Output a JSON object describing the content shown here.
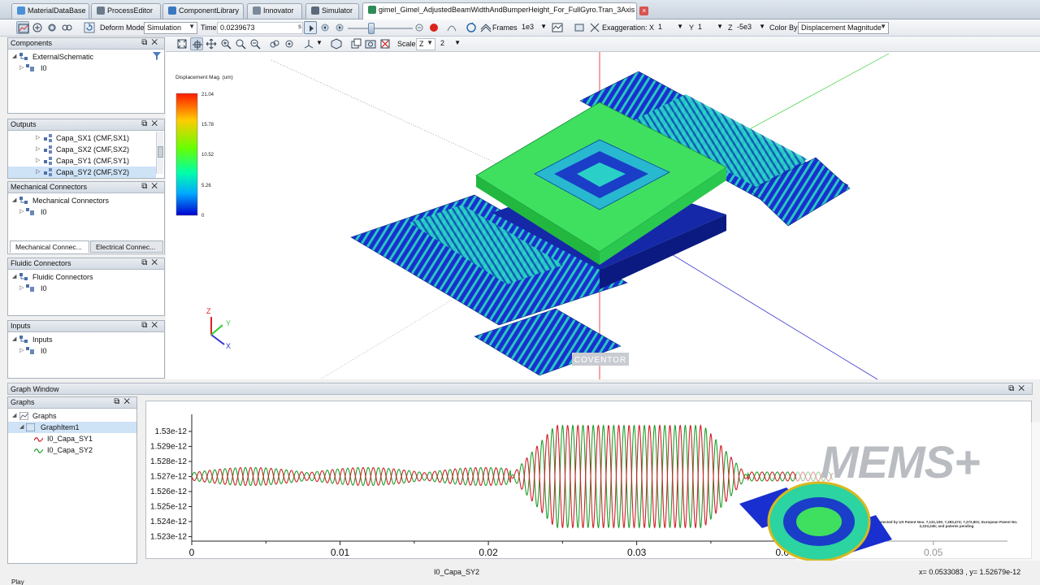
{
  "tabs": [
    {
      "label": "MaterialDataBase",
      "color": "#4a90d9"
    },
    {
      "label": "ProcessEditor",
      "color": "#6b7b8c"
    },
    {
      "label": "ComponentLibrary",
      "color": "#3b78c2"
    },
    {
      "label": "Innovator",
      "color": "#7a8a9a"
    },
    {
      "label": "Simulator",
      "color": "#5a6a7a"
    },
    {
      "label": "gimel_Gimel_AdjustedBeamWidthAndBumperHeight_For_FullGyro.Tran_3Axis",
      "color": "#2e8b57"
    }
  ],
  "toolbar1": {
    "deform_mode_label": "Deform Mode",
    "deform_mode_value": "Simulation",
    "time_label": "Time",
    "time_value": "0.0239673",
    "time_unit": "s",
    "frames_label": "Frames",
    "frames_value": "1e3",
    "exaggeration_label": "Exaggeration: X",
    "exag_x": "1",
    "y_label": "Y",
    "exag_y": "1",
    "z_label": "Z",
    "exag_z": "-5e3",
    "color_by_label": "Color By",
    "color_by_value": "Displacement Magnitude",
    "time_slider_fraction": 0.36
  },
  "toolbar2": {
    "scale_label": "Scale",
    "scale_axis": "Z",
    "scale_value": "2"
  },
  "panels": {
    "components": {
      "title": "Components",
      "items": [
        "ExternalSchematic",
        "I0"
      ]
    },
    "outputs": {
      "title": "Outputs",
      "items": [
        "Capa_SX1 (CMF,SX1)",
        "Capa_SX2 (CMF,SX2)",
        "Capa_SY1 (CMF,SY1)",
        "Capa_SY2 (CMF,SY2)"
      ]
    },
    "mechanical": {
      "title": "Mechanical Connectors",
      "items": [
        "Mechanical Connectors",
        "I0"
      ],
      "tabs": [
        "Mechanical Connec...",
        "Electrical Connec..."
      ]
    },
    "fluidic": {
      "title": "Fluidic Connectors",
      "items": [
        "Fluidic Connectors",
        "I0"
      ]
    },
    "inputs": {
      "title": "Inputs",
      "items": [
        "Inputs",
        "I0"
      ]
    }
  },
  "viewport": {
    "legend_title": "Displacement Mag. (um)",
    "legend_ticks": [
      "21.04",
      "15.78",
      "10.52",
      "5.26",
      "0"
    ],
    "axis_z": "Z",
    "axis_y": "Y",
    "axis_x": "X",
    "watermark": "COVENTOR"
  },
  "graph": {
    "window_title": "Graph Window",
    "panel_title": "Graphs",
    "tree": [
      "Graphs",
      "GraphItem1",
      "I0_Capa_SY1",
      "I0_Capa_SY2"
    ],
    "series_colors": {
      "sy1": "#d0202a",
      "sy2": "#1fa02a"
    },
    "x_axis_label": "I0_Capa_SY2",
    "status": "x= 0.0533083 , y= 1.52679e-12"
  },
  "chart_data": {
    "type": "line",
    "x_ticks": [
      "0",
      "0.01",
      "0.02",
      "0.03",
      "0.04",
      "0.05"
    ],
    "y_ticks": [
      "1.53e-12",
      "1.529e-12",
      "1.528e-12",
      "1.527e-12",
      "1.526e-12",
      "1.525e-12",
      "1.524e-12",
      "1.523e-12"
    ],
    "xlim": [
      0,
      0.055
    ],
    "ylim": [
      1.5227e-12,
      1.5307e-12
    ],
    "series": [
      {
        "name": "I0_Capa_SY1",
        "baseline": 1.527e-12
      },
      {
        "name": "I0_Capa_SY2",
        "baseline": 1.527e-12
      }
    ]
  },
  "branding": {
    "logo": "MEMS+",
    "patent": "Protected by US Patent Nos. 7,131,105; 7,283,474; 7,272,801; European Patent No. 2,223,245; and patents pending"
  },
  "statusbar": {
    "text": "Play"
  }
}
